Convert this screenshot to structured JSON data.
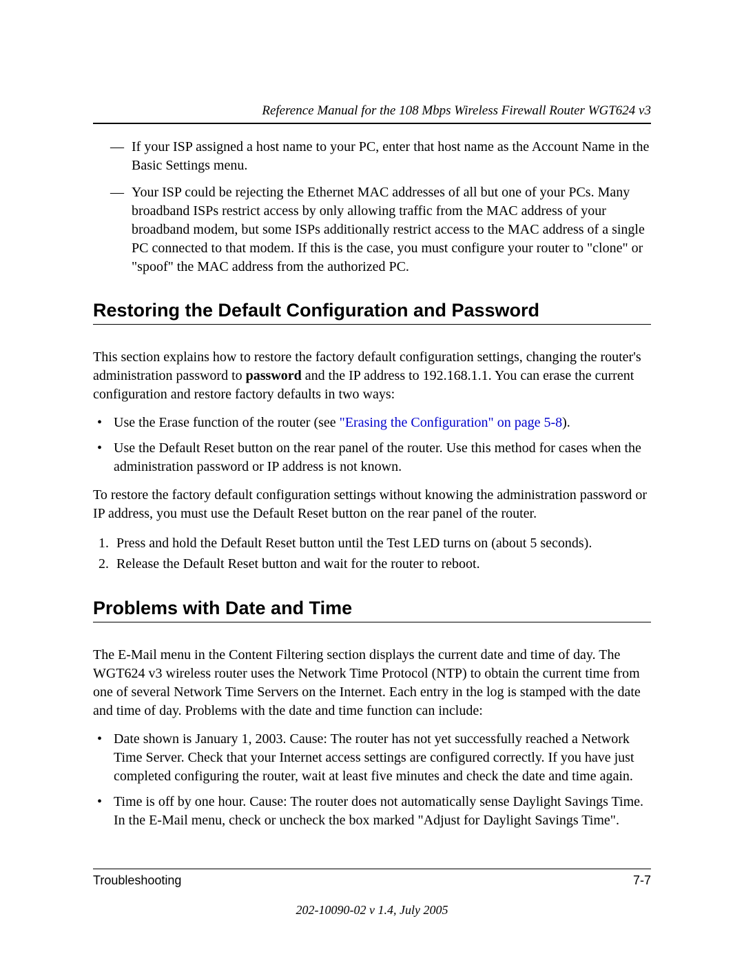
{
  "header": {
    "running_title": "Reference Manual for the 108 Mbps Wireless Firewall Router WGT624 v3"
  },
  "intro_dashed": [
    "If your ISP assigned a host name to your PC, enter that host name as the Account Name in the Basic Settings menu.",
    "Your ISP could be rejecting the Ethernet MAC addresses of all but one of your PCs. Many broadband ISPs restrict access by only allowing traffic from the MAC address of your broadband modem, but some ISPs additionally restrict access to the MAC address of a single PC connected to that modem. If this is the case, you must configure your router to \"clone\" or \"spoof\" the MAC address from the authorized PC."
  ],
  "section1": {
    "title": "Restoring the Default Configuration and Password",
    "para1_a": "This section explains how to restore the factory default configuration settings, changing the router's administration password to ",
    "para1_bold": "password",
    "para1_b": " and the IP address to 192.168.1.1. You can erase the current configuration and restore factory defaults in two ways:",
    "bullets": [
      {
        "pre": "Use the Erase function of the router (see ",
        "link": "\"Erasing the Configuration\" on page 5-8",
        "post": ")."
      },
      {
        "pre": "Use the Default Reset button on the rear panel of the router. Use this method for cases when the administration password or IP address is not known.",
        "link": "",
        "post": ""
      }
    ],
    "para2": "To restore the factory default configuration settings without knowing the administration password or IP address, you must use the Default Reset button on the rear panel of the router.",
    "steps": [
      "Press and hold the Default Reset button until the Test LED turns on (about 5 seconds).",
      "Release the Default Reset button and wait for the router to reboot."
    ]
  },
  "section2": {
    "title": "Problems with Date and Time",
    "para1": "The E-Mail menu in the Content Filtering section displays the current date and time of day. The WGT624 v3 wireless router uses the Network Time Protocol (NTP) to obtain the current time from one of several Network Time Servers on the Internet. Each entry in the log is stamped with the date and time of day. Problems with the date and time function can include:",
    "bullets": [
      "Date shown is January 1, 2003. Cause: The router has not yet successfully reached a Network Time Server. Check that your Internet access settings are configured correctly. If you have just completed configuring the router, wait at least five minutes and check the date and time again.",
      "Time is off by one hour. Cause: The router does not automatically sense Daylight Savings Time. In the E-Mail menu, check or uncheck the box marked \"Adjust for Daylight Savings Time\"."
    ]
  },
  "footer": {
    "chapter": "Troubleshooting",
    "page_number": "7-7",
    "version": "202-10090-02 v 1.4, July 2005"
  }
}
